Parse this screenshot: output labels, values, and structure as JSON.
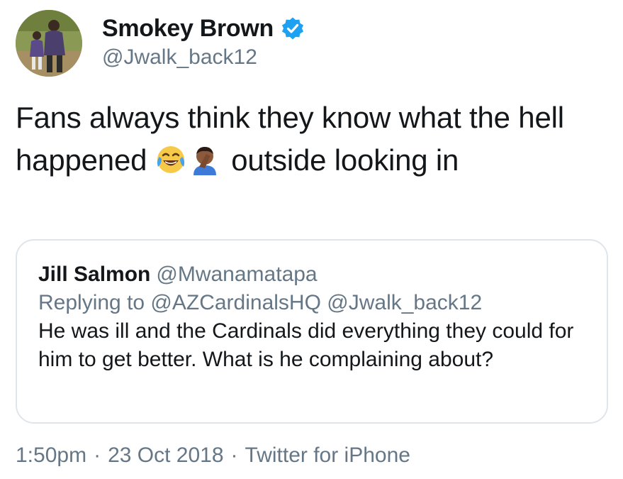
{
  "author": {
    "name": "Smokey Brown",
    "handle": "@Jwalk_back12",
    "verified": true,
    "verified_color": "#1da1f2"
  },
  "tweet": {
    "text_part1": "Fans always think they know what the hell happened",
    "emojis": [
      "face-with-tears-of-joy",
      "person-facepalming"
    ],
    "text_part2": "outside looking in"
  },
  "quote": {
    "name": "Jill Salmon",
    "handle": "@Mwanamatapa",
    "reply_line": "Replying to @AZCardinalsHQ @Jwalk_back12",
    "body": "He was ill and the Cardinals did everything they could for him to get better. What is he complaining about?"
  },
  "meta": {
    "time": "1:50pm",
    "date": "23 Oct 2018",
    "source": "Twitter for iPhone",
    "separator": "·"
  },
  "colors": {
    "text": "#14171a",
    "secondary": "#657786",
    "border": "#dfe5ea"
  }
}
